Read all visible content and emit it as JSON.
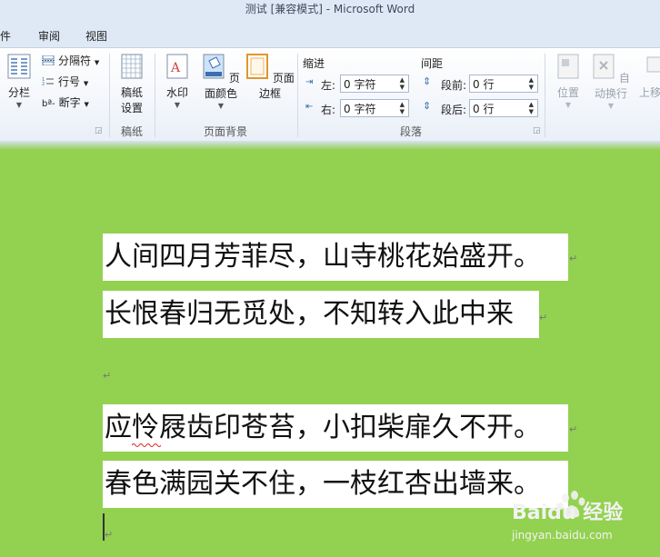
{
  "window": {
    "title": "测试 [兼容模式] - Microsoft Word"
  },
  "tabs": [
    "件",
    "审阅",
    "视图"
  ],
  "ribbon": {
    "columns_label": "分栏",
    "breaks_label": "分隔符",
    "line_numbers_label": "行号",
    "hyphenation_label": "断字",
    "manuscript_settings_line1": "稿纸",
    "manuscript_settings_line2": "设置",
    "manuscript_group_label": "稿纸",
    "watermark_label": "水印",
    "page_color_label": "页面颜色",
    "page_borders_label": "页面边框",
    "page_background_group_label": "页面背景",
    "indent_header": "缩进",
    "indent_left_label": "左:",
    "indent_left_value": "0 字符",
    "indent_right_label": "右:",
    "indent_right_value": "0 字符",
    "spacing_header": "间距",
    "spacing_before_label": "段前:",
    "spacing_before_value": "0 行",
    "spacing_after_label": "段后:",
    "spacing_after_value": "0 行",
    "paragraph_group_label": "段落",
    "position_label": "位置",
    "wrap_text_label": "自动换行",
    "bring_forward_label": "上移"
  },
  "document": {
    "lines": [
      "人间四月芳菲尽，山寺桃花始盛开。",
      "长恨春归无觅处，不知转入此中来",
      "应怜屐齿印苍苔，小扣柴扉久不开。",
      "春色满园关不住，一枝红杏出墙来。"
    ],
    "paragraph_mark": "↵",
    "background_color": "#93d150"
  },
  "watermark": {
    "logo_text": "Baidu 经验",
    "url_text": "jingyan.baidu.com"
  }
}
